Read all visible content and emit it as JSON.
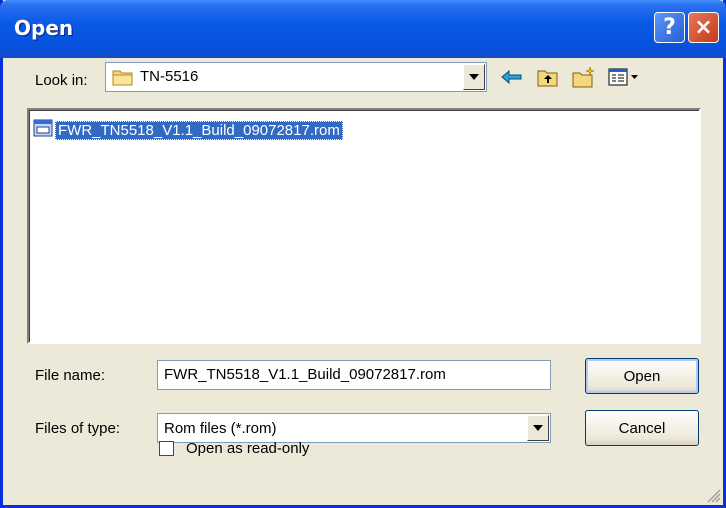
{
  "window": {
    "title": "Open",
    "help_label": "?",
    "close_label": "×"
  },
  "lookin": {
    "label": "Look in:",
    "value": "TN-5516",
    "icons": [
      "folder-icon",
      "back-arrow-icon",
      "up-folder-icon",
      "new-folder-icon",
      "view-menu-icon"
    ]
  },
  "files": [
    {
      "name": "FWR_TN5518_V1.1_Build_09072817.rom",
      "icon": "rom-file-icon",
      "selected": true
    }
  ],
  "filename": {
    "label": "File name:",
    "value": "FWR_TN5518_V1.1_Build_09072817.rom"
  },
  "filetype": {
    "label": "Files of type:",
    "value": "Rom files (*.rom)"
  },
  "buttons": {
    "open": "Open",
    "cancel": "Cancel"
  },
  "readonly": {
    "label": "Open as read-only",
    "checked": false
  },
  "colors": {
    "titlebar": "#0a58e6",
    "selection": "#316ac5",
    "dialog_bg": "#ece9d8"
  }
}
